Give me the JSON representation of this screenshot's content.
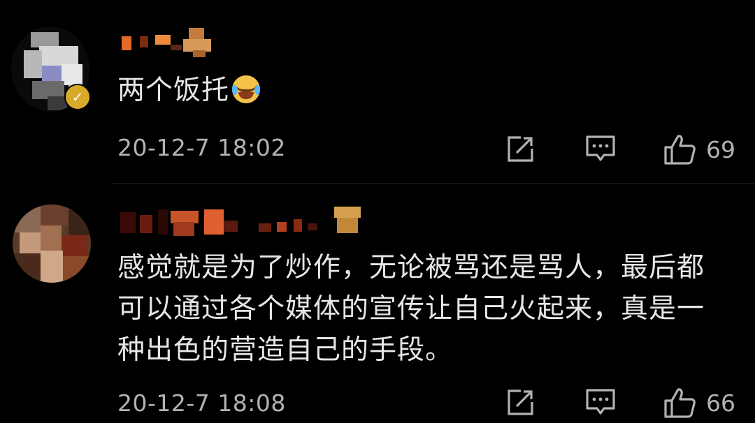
{
  "comments": [
    {
      "text": "两个饭托",
      "timestamp": "20-12-7 18:02",
      "likes": "69",
      "has_emoji": true,
      "verified": true
    },
    {
      "text": "感觉就是为了炒作，无论被骂还是骂人，最后都可以通过各个媒体的宣传让自己火起来，真是一种出色的营造自己的手段。",
      "timestamp": "20-12-7 18:08",
      "likes": "66",
      "has_emoji": false,
      "verified": false
    }
  ],
  "icons": {
    "share": "share-icon",
    "reply": "comment-icon",
    "like": "thumbs-up-icon",
    "emoji": "laughing-crying-emoji"
  },
  "colors": {
    "background": "#000000",
    "text": "#e6e6e6",
    "meta": "#b2b2b2",
    "verified_badge": "#d9a92a"
  }
}
